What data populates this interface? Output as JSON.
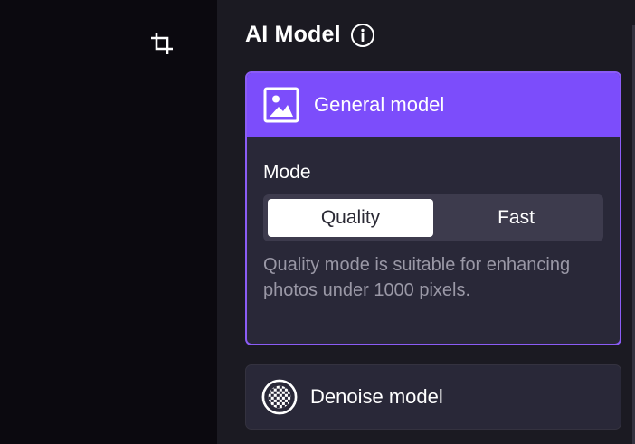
{
  "toolbar": {
    "crop_icon": "crop-icon"
  },
  "panel": {
    "title": "AI Model",
    "info_icon": "info-icon"
  },
  "models": {
    "general": {
      "label": "General model",
      "icon": "image-icon",
      "mode_label": "Mode",
      "options": [
        "Quality",
        "Fast"
      ],
      "selected": "Quality",
      "description": "Quality mode is suitable for enhancing photos under 1000 pixels."
    },
    "denoise": {
      "label": "Denoise model",
      "icon": "denoise-icon"
    }
  },
  "colors": {
    "accent": "#7c4dfb",
    "accent_border": "#8b5cf6",
    "panel_bg": "#1b1a22",
    "card_bg": "#292838"
  }
}
